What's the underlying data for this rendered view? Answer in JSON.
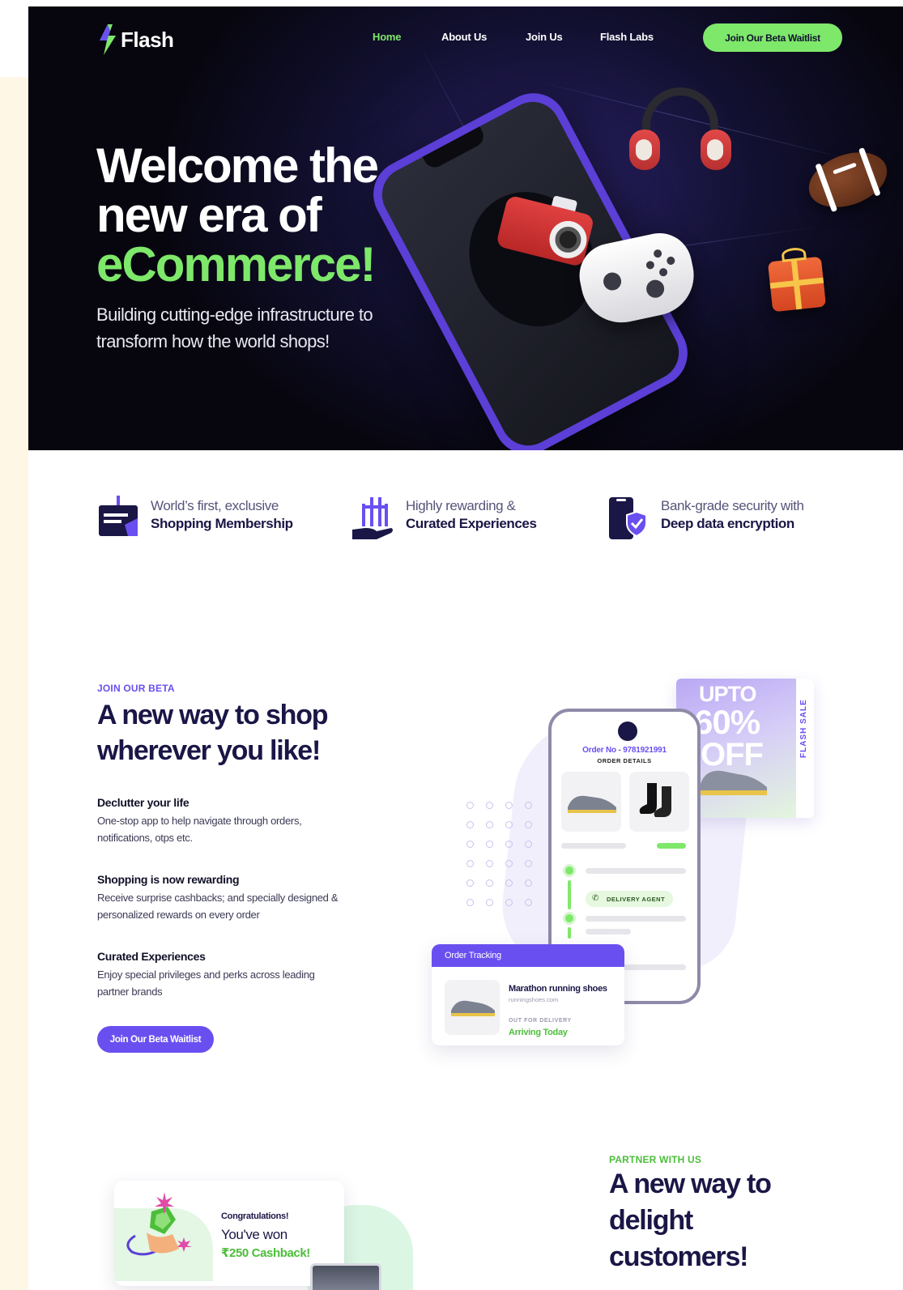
{
  "brand": {
    "name": "Flash",
    "accent": "#7ee86a",
    "purple": "#6a4ff0",
    "navy": "#1a1646"
  },
  "nav": {
    "items": [
      {
        "label": "Home",
        "active": true
      },
      {
        "label": "About Us",
        "active": false
      },
      {
        "label": "Join Us",
        "active": false
      },
      {
        "label": "Flash Labs",
        "active": false
      }
    ],
    "cta": "Join Our Beta Waitlist"
  },
  "hero": {
    "title_line1": "Welcome the",
    "title_line2": "new era of",
    "title_highlight": "eCommerce!",
    "subtitle": "Building cutting-edge infrastructure to transform how the world shops!"
  },
  "features": [
    {
      "line1": "World’s first, exclusive",
      "line2": "Shopping Membership",
      "icon": "membership-card-icon"
    },
    {
      "line1": "Highly rewarding &",
      "line2": "Curated Experiences",
      "icon": "gift-hand-icon"
    },
    {
      "line1": "Bank-grade security with",
      "line2": "Deep data encryption",
      "icon": "secure-phone-icon"
    }
  ],
  "beta": {
    "eyebrow": "JOIN OUR BETA",
    "title_line1": "A new way to shop",
    "title_line2": "wherever you like!",
    "points": [
      {
        "title": "Declutter your life",
        "desc": "One-stop app to help navigate through orders, notifications, otps etc."
      },
      {
        "title": "Shopping is now rewarding",
        "desc": "Receive surprise cashbacks; and specially designed & personalized rewards on every order"
      },
      {
        "title": "Curated Experiences",
        "desc": "Enjoy special privileges and perks across leading partner brands"
      }
    ],
    "cta": "Join Our Beta Waitlist"
  },
  "mock": {
    "order_no": "Order No - 9781921991",
    "order_details": "ORDER DETAILS",
    "delivery_agent": "DELIVERY AGENT",
    "sale_line1": "UPTO",
    "sale_line2": "60%",
    "sale_line3": "OFF",
    "sale_tag": "FLASH SALE",
    "tracking": {
      "header": "Order Tracking",
      "product": "Marathon running shoes",
      "site": "runningshoes.com",
      "status": "OUT FOR DELIVERY",
      "eta": "Arriving Today"
    }
  },
  "partner": {
    "eyebrow": "PARTNER WITH US",
    "title_line1": "A new way to",
    "title_line2": "delight",
    "title_line3": "customers!",
    "card": {
      "congrats": "Congratulations!",
      "won": "You've won",
      "amount": "₹250 Cashback!"
    }
  }
}
